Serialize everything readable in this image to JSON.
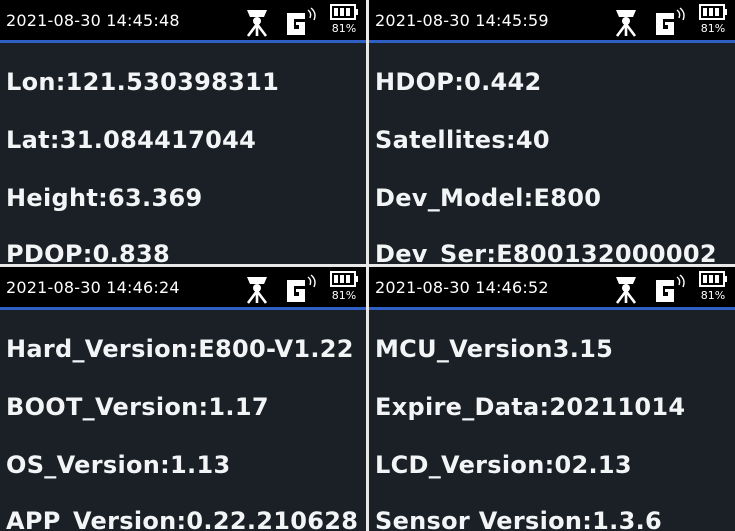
{
  "battery": {
    "percent": "81%"
  },
  "panels": [
    {
      "timestamp": "2021-08-30 14:45:48",
      "lines": [
        "Lon:121.530398311",
        "Lat:31.084417044",
        "Height:63.369",
        "PDOP:0.838"
      ]
    },
    {
      "timestamp": "2021-08-30 14:45:59",
      "lines": [
        "HDOP:0.442",
        "Satellites:40",
        "Dev_Model:E800",
        "Dev_Ser:E800132000002"
      ]
    },
    {
      "timestamp": "2021-08-30 14:46:24",
      "lines": [
        "Hard_Version:E800-V1.22",
        "BOOT_Version:1.17",
        "OS_Version:1.13",
        "APP_Version:0.22.210628"
      ]
    },
    {
      "timestamp": "2021-08-30 14:46:52",
      "lines": [
        "MCU_Version3.15",
        "Expire_Data:20211014",
        "LCD_Version:02.13",
        "Sensor Version:1.3.6"
      ]
    }
  ],
  "icons": {
    "rtk": "rtk-antenna-icon",
    "network": "gsm-signal-icon",
    "battery": "battery-icon"
  },
  "colors": {
    "screen_bg": "#1a2026",
    "status_bg": "#000000",
    "status_border": "#2f5fc4",
    "text": "#f2f4f6"
  }
}
